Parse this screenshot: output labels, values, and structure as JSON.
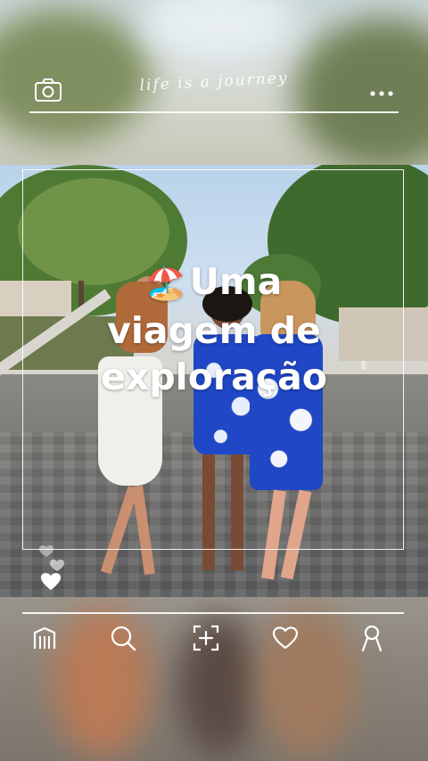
{
  "header": {
    "title": "life is a journey",
    "camera_icon": "camera-icon",
    "menu_icon": "more-dots-icon"
  },
  "post": {
    "caption_emoji": "🏖️",
    "caption_line1": "Uma",
    "caption_line2": "viagem de",
    "caption_line3": "exploração"
  },
  "bottom_nav": {
    "items": [
      {
        "icon": "home-icon"
      },
      {
        "icon": "search-icon"
      },
      {
        "icon": "add-post-icon"
      },
      {
        "icon": "heart-icon"
      },
      {
        "icon": "profile-icon"
      }
    ]
  },
  "colors": {
    "frame": "#ffffff",
    "dress_blue": "#1f47c6"
  }
}
